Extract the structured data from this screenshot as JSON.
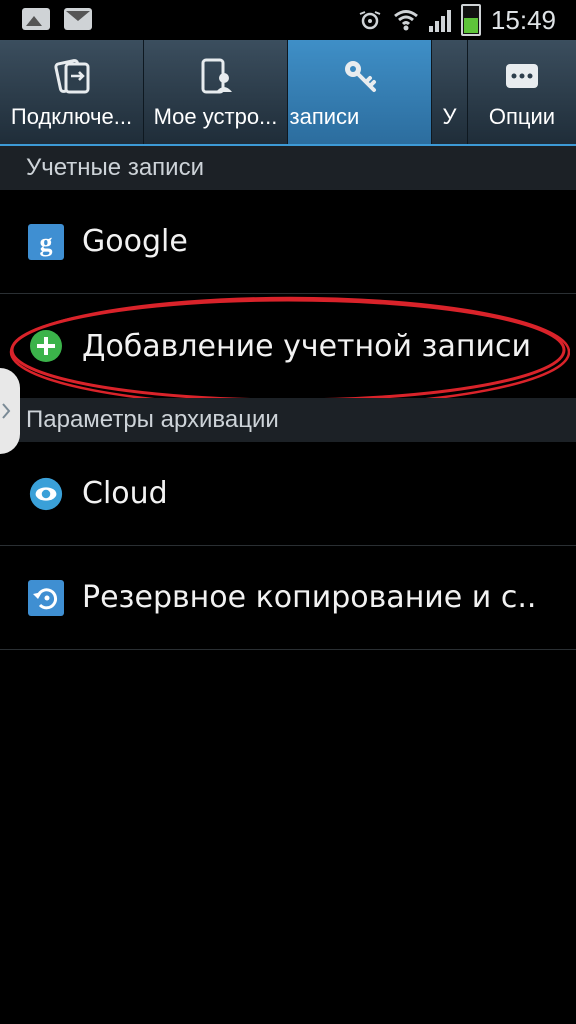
{
  "status": {
    "time": "15:49"
  },
  "tabs": [
    {
      "label": "Подключе...",
      "icon": "connections-icon"
    },
    {
      "label": "Мое устро...",
      "icon": "my-device-icon"
    },
    {
      "label": "записи",
      "icon": "accounts-key-icon"
    },
    {
      "label": "У",
      "icon": ""
    },
    {
      "label": "Опции",
      "icon": "more-options-icon"
    }
  ],
  "sections": {
    "accounts": "Учетные записи",
    "backup": "Параметры архивации"
  },
  "items": {
    "google": "Google",
    "add_account": "Добавление учетной записи",
    "cloud": "Cloud",
    "backup": "Резервное копирование и с.."
  },
  "colors": {
    "accent": "#3d9ad6",
    "highlight_circle": "#d9232a",
    "add_icon": "#3bb34a"
  }
}
